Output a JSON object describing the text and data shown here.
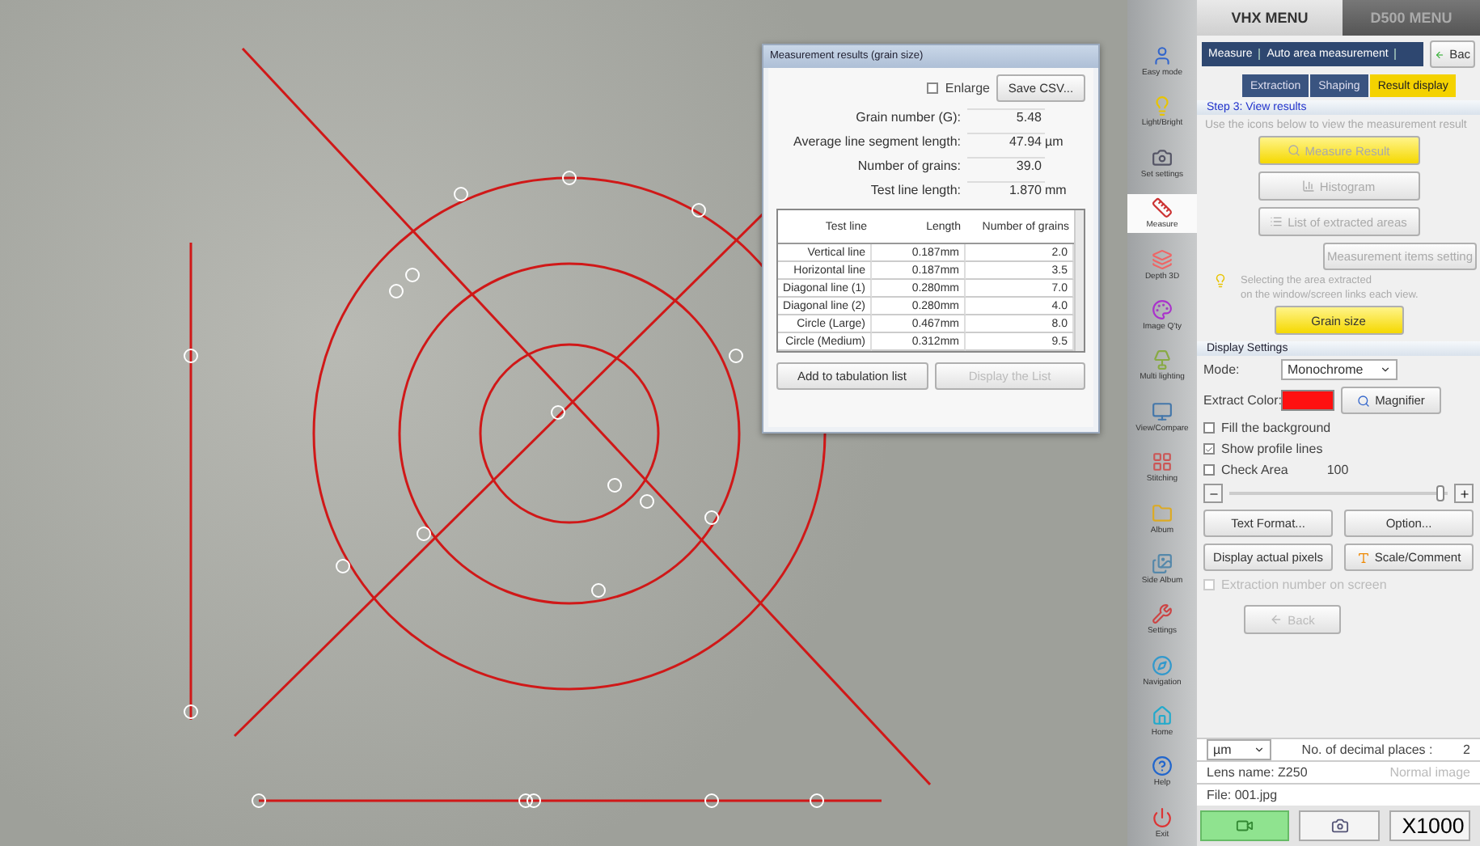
{
  "results_dialog": {
    "title": "Measurement results (grain size)",
    "enlarge": {
      "label": "Enlarge",
      "checked": false
    },
    "save_button": "Save CSV...",
    "stats": [
      {
        "label": "Grain number (G):",
        "value": "5.48"
      },
      {
        "label": "Average line segment length:",
        "value": "47.94",
        "unit": "µm"
      },
      {
        "label": "Number of grains:",
        "value": "39.0"
      },
      {
        "label": "Test line length:",
        "value": "1.870",
        "unit": "mm"
      }
    ],
    "table": {
      "columns": [
        "Test line",
        "Length",
        "Number of grains"
      ],
      "rows": [
        [
          "Vertical line",
          "0.187mm",
          "2.0"
        ],
        [
          "Horizontal line",
          "0.187mm",
          "3.5"
        ],
        [
          "Diagonal line (1)",
          "0.280mm",
          "7.0"
        ],
        [
          "Diagonal line (2)",
          "0.280mm",
          "4.0"
        ],
        [
          "Circle (Large)",
          "0.467mm",
          "8.0"
        ],
        [
          "Circle (Medium)",
          "0.312mm",
          "9.5"
        ]
      ]
    },
    "buttons": [
      {
        "label": "Add to tabulation list",
        "disabled": false
      },
      {
        "label": "Display the List",
        "disabled": true
      }
    ]
  },
  "sidebar": {
    "items": [
      {
        "label": "Easy mode",
        "selected": false
      },
      {
        "label": "Light/Bright",
        "selected": false
      },
      {
        "label": "Set settings",
        "selected": false
      },
      {
        "label": "Measure",
        "selected": true
      },
      {
        "label": "Depth 3D",
        "selected": false
      },
      {
        "label": "Image Q'ty",
        "selected": false
      },
      {
        "label": "Multi lighting",
        "selected": false
      },
      {
        "label": "View/Compare",
        "selected": false
      },
      {
        "label": "Stitching",
        "selected": false
      },
      {
        "label": "Album",
        "selected": false
      },
      {
        "label": "Side Album",
        "selected": false
      },
      {
        "label": "Settings",
        "selected": false
      },
      {
        "label": "Navigation",
        "selected": false
      },
      {
        "label": "Home",
        "selected": false
      },
      {
        "label": "Help",
        "selected": false
      },
      {
        "label": "Exit",
        "selected": false
      }
    ]
  },
  "panel": {
    "tabs": [
      {
        "label": "VHX MENU",
        "selected": true
      },
      {
        "label": "D500 MENU",
        "selected": false
      }
    ],
    "breadcrumb": [
      "Measure",
      "Auto area measurement"
    ],
    "back_top": "Bac",
    "steps": [
      {
        "label": "Extraction",
        "selected": false
      },
      {
        "label": "Shaping",
        "selected": false
      },
      {
        "label": "Result display",
        "selected": true
      }
    ],
    "step_title": "Step 3: View results",
    "instruction": "Use the icons below to view the measurement result",
    "view_buttons": [
      {
        "label": "Measure Result",
        "selected": true
      },
      {
        "label": "Histogram",
        "selected": false
      },
      {
        "label": "List of extracted areas",
        "selected": false
      }
    ],
    "items_setting": "Measurement items setting",
    "tip": [
      "Selecting the area extracted",
      "on the window/screen links each view."
    ],
    "grain_button": "Grain size",
    "display_settings": {
      "title": "Display Settings",
      "mode_label": "Mode:",
      "mode": "Monochrome",
      "color_label": "Extract Color:",
      "color": "#ff1010",
      "magnifier": "Magnifier",
      "checks": [
        {
          "label": "Fill the background",
          "checked": false
        },
        {
          "label": "Show profile lines",
          "checked": true
        },
        {
          "label": "Check Area",
          "checked": false
        }
      ],
      "area_value": "100",
      "slider": {
        "level": 0.97
      },
      "buttons": [
        "Text Format...",
        "Option...",
        "Display actual pixels",
        "Scale/Comment"
      ],
      "extraction_number": {
        "label": "Extraction number on screen",
        "checked": false,
        "disabled": true
      },
      "back": "Back"
    },
    "unit": "µm",
    "decimal_label": "No. of decimal places :",
    "decimals": "2",
    "lens": "Lens name: Z250",
    "image_mode": "Normal image",
    "file": "File: 001.jpg",
    "zoom": "X1000"
  }
}
